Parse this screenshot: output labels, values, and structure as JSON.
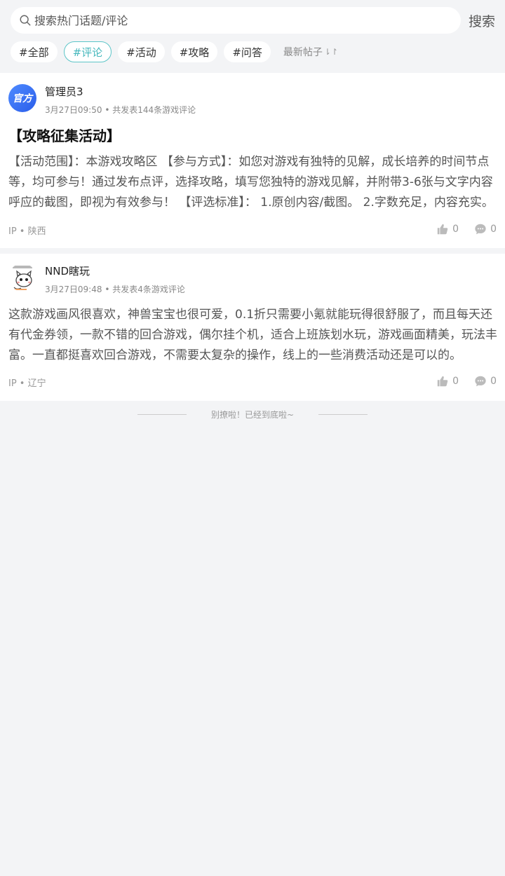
{
  "search": {
    "placeholder": "搜索热门话题/评论",
    "button_label": "搜索"
  },
  "tags": [
    {
      "label": "#全部",
      "active": false
    },
    {
      "label": "#评论",
      "active": true
    },
    {
      "label": "#活动",
      "active": false
    },
    {
      "label": "#攻略",
      "active": false
    },
    {
      "label": "#问答",
      "active": false
    }
  ],
  "sort": {
    "label": "最新帖子",
    "icon": "sort-icon"
  },
  "posts": [
    {
      "avatar_text": "官方",
      "username": "管理员3",
      "time": "3月27日09:50",
      "stats": "共发表144条游戏评论",
      "title": "【攻略征集活动】",
      "body": "【活动范围】：本游戏攻略区 【参与方式】：如您对游戏有独特的见解，成长培养的时间节点等，均可参与！通过发布点评，选择攻略，填写您独特的游戏见解，并附带3-6张与文字内容呼应的截图，即视为有效参与！ 【评选标准】： 1.原创内容/截图。 2.字数充足，内容充实。",
      "ip": "IP • 陕西",
      "likes": "0",
      "comments": "0"
    },
    {
      "avatar_text": "",
      "username": "NND瞎玩",
      "time": "3月27日09:48",
      "stats": "共发表4条游戏评论",
      "title": "",
      "body": "这款游戏画风很喜欢，神兽宝宝也很可爱，0.1折只需要小氪就能玩得很舒服了，而且每天还有代金券领，一款不错的回合游戏，偶尔挂个机，适合上班族划水玩，游戏画面精美，玩法丰富。一直都挺喜欢回合游戏，不需要太复杂的操作，线上的一些消费活动还是可以的。",
      "ip": "IP • 辽宁",
      "likes": "0",
      "comments": "0"
    }
  ],
  "footer": {
    "end_text": "别撩啦！已经到底啦~"
  },
  "colors": {
    "accent": "#46b8bd",
    "background": "#f3f4f6",
    "official_avatar": "#3a6ff0"
  }
}
